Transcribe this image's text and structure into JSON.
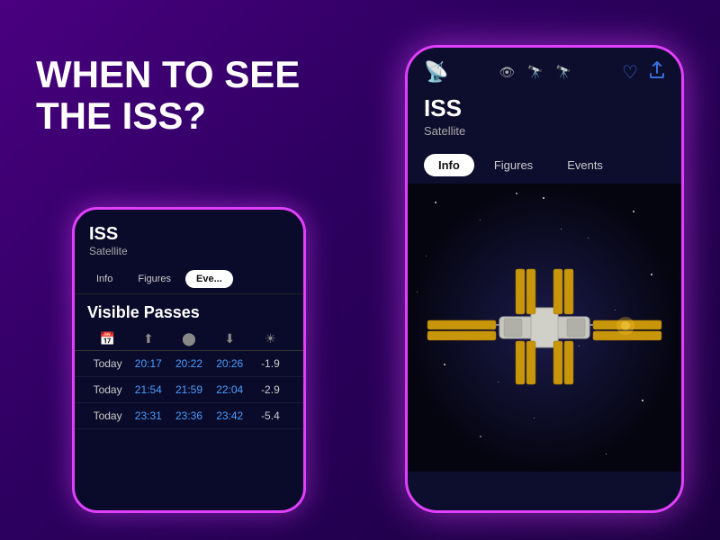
{
  "background": {
    "gradient_start": "#4a0080",
    "gradient_end": "#1a0040"
  },
  "headline": {
    "line1": "WHEN TO SEE",
    "line2": "THE ISS?"
  },
  "phone_right": {
    "satellite_icon": "📡",
    "view_icons": [
      "👁",
      "🔭",
      "🔭"
    ],
    "heart_icon": "♡",
    "share_icon": "↑",
    "title": "ISS",
    "subtitle": "Satellite",
    "tabs": [
      {
        "label": "Info",
        "active": true
      },
      {
        "label": "Figures",
        "active": false
      },
      {
        "label": "Events",
        "active": false
      }
    ],
    "image_alt": "ISS Space Station"
  },
  "phone_left": {
    "title": "ISS",
    "subtitle": "Satellite",
    "tabs": [
      {
        "label": "Info",
        "active": false
      },
      {
        "label": "Figures",
        "active": false
      },
      {
        "label": "Eve...",
        "active": true
      }
    ],
    "section_title": "Visible Passes",
    "table_headers": [
      "📅",
      "⬆",
      "⬤",
      "⬇",
      "☀"
    ],
    "rows": [
      {
        "day": "Today",
        "start": "20:17",
        "peak": "20:22",
        "end": "20:26",
        "mag": "-1.9"
      },
      {
        "day": "Today",
        "start": "21:54",
        "peak": "21:59",
        "end": "22:04",
        "mag": "-2.9"
      },
      {
        "day": "Today",
        "start": "23:31",
        "peak": "23:36",
        "end": "23:42",
        "mag": "-5.4"
      }
    ]
  }
}
